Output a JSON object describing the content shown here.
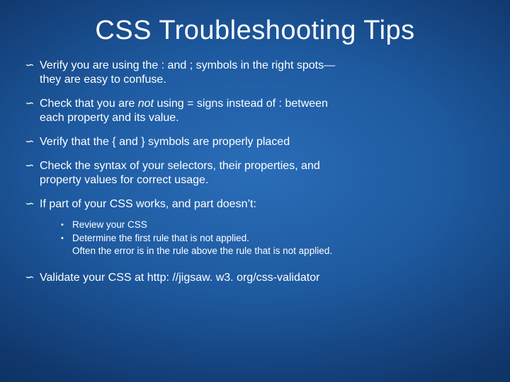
{
  "title": "CSS Troubleshooting Tips",
  "bullet_glyph": "∽",
  "sub_glyph": "•",
  "items": {
    "b1a": "Verify you are using the : and ; symbols in the right spots—",
    "b1b": "they are easy to confuse.",
    "b2a": "Check that you are ",
    "b2not": "not",
    "b2b": " using = signs instead of : between",
    "b2c": "each property and its value.",
    "b3": "Verify that the { and } symbols are properly placed",
    "b4a": "Check the syntax of your selectors, their properties, and",
    "b4b": "property values for correct usage.",
    "b5": " If part of your CSS works, and part doesn’t:",
    "s1": "Review your CSS",
    "s2a": "Determine the first rule that is not applied.",
    "s2b": "Often the error is in the rule above the rule that is not applied.",
    "b6": "Validate your CSS at http: //jigsaw. w3. org/css-validator"
  }
}
